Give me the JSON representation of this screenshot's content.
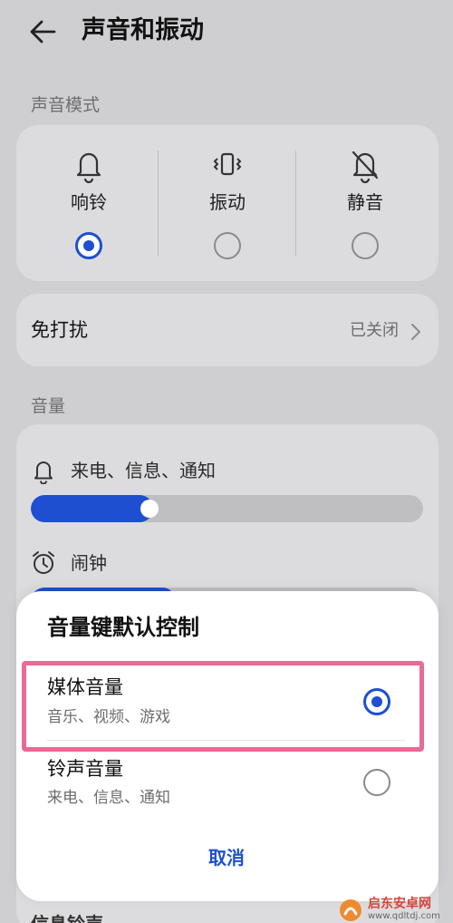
{
  "header": {
    "title": "声音和振动"
  },
  "sound_mode": {
    "section_label": "声音模式",
    "options": [
      {
        "label": "响铃",
        "icon": "bell-icon",
        "selected": true
      },
      {
        "label": "振动",
        "icon": "vibrate-icon",
        "selected": false
      },
      {
        "label": "静音",
        "icon": "bell-off-icon",
        "selected": false
      }
    ]
  },
  "dnd": {
    "label": "免打扰",
    "value": "已关闭"
  },
  "volume": {
    "section_label": "音量",
    "rows": [
      {
        "label": "来电、信息、通知",
        "icon": "bell-icon",
        "level": 0.28
      },
      {
        "label": "闹钟",
        "icon": "alarm-clock-icon"
      }
    ],
    "peek_label": "信息铃声"
  },
  "dialog": {
    "title": "音量键默认控制",
    "options": [
      {
        "title": "媒体音量",
        "subtitle": "音乐、视频、游戏",
        "selected": true
      },
      {
        "title": "铃声音量",
        "subtitle": "来电、信息、通知",
        "selected": false
      }
    ],
    "cancel_label": "取消"
  },
  "watermark": {
    "text": "启东安卓网",
    "url": "www.qdltdj.com"
  },
  "colors": {
    "accent": "#1d4fd0",
    "highlight": "#ea6a93",
    "background": "#cfcfd1"
  }
}
